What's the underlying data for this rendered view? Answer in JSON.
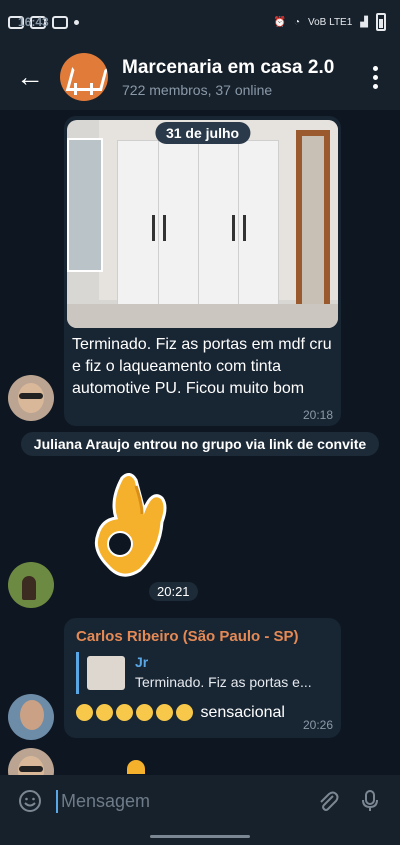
{
  "status_bar": {
    "time": "16:43",
    "network": "VoB LTE1"
  },
  "header": {
    "title": "Marcenaria em casa 2.0",
    "subtitle": "722 membros, 37 online"
  },
  "date_separator": "31 de julho",
  "messages": [
    {
      "text": "Terminado. Fiz as portas em mdf cru e fiz o laqueamento com tinta automotive PU. Ficou muito bom",
      "time": "20:18"
    },
    {
      "service": "Juliana Araujo entrou no grupo via link de convite"
    },
    {
      "sticker": "ok-hand",
      "time": "20:21"
    },
    {
      "author": "Carlos Ribeiro (São Paulo - SP)",
      "reply_to": {
        "name": "Jr",
        "text": "Terminado. Fiz as portas e..."
      },
      "text": "sensacional",
      "time": "20:26"
    }
  ],
  "input": {
    "placeholder": "Mensagem"
  }
}
